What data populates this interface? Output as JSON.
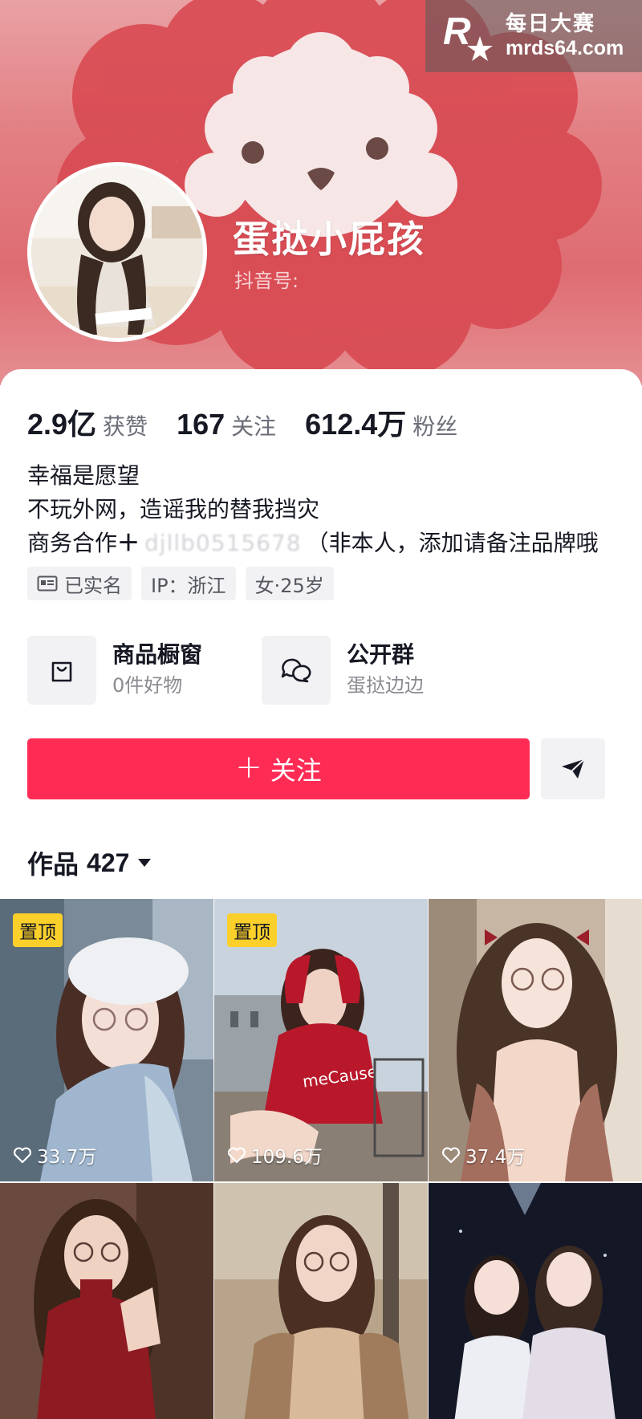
{
  "watermark": {
    "brand_cn": "每日大赛",
    "url": "mrds64.com"
  },
  "profile": {
    "nickname": "蛋挞小屁孩",
    "douyin_id_label": "抖音号:"
  },
  "stats": [
    {
      "value": "2.9亿",
      "label": "获赞"
    },
    {
      "value": "167",
      "label": "关注"
    },
    {
      "value": "612.4万",
      "label": "粉丝"
    }
  ],
  "bio": {
    "line1": "幸福是愿望",
    "line2": "不玩外网，造谣我的替我挡灾",
    "line3_prefix": "商务合作",
    "line3_masked": "djllb0515678",
    "line3_suffix": "（非本人，添加请备注品牌哦"
  },
  "tags": [
    {
      "icon": "id-card-icon",
      "label": "已实名"
    },
    {
      "icon": "",
      "label": "IP：浙江"
    },
    {
      "icon": "",
      "label": "女·25岁"
    }
  ],
  "entries": [
    {
      "icon": "shopping-bag-icon",
      "title": "商品橱窗",
      "subtitle": "0件好物"
    },
    {
      "icon": "group-chat-icon",
      "title": "公开群",
      "subtitle": "蛋挞边边"
    }
  ],
  "actions": {
    "follow_plus": "+",
    "follow_label": "关注",
    "share_icon": "send-icon"
  },
  "works": {
    "label": "作品",
    "count": "427"
  },
  "colors": {
    "accent": "#fe2c55",
    "pin_badge": "#fcd02b",
    "banner": "#e27f83"
  },
  "grid": [
    {
      "pinned": true,
      "pin_label": "置顶",
      "likes": "33.7万"
    },
    {
      "pinned": true,
      "pin_label": "置顶",
      "likes": "109.6万"
    },
    {
      "pinned": false,
      "pin_label": "",
      "likes": "37.4万"
    },
    {
      "pinned": false,
      "pin_label": "",
      "likes": ""
    },
    {
      "pinned": false,
      "pin_label": "",
      "likes": ""
    },
    {
      "pinned": false,
      "pin_label": "",
      "likes": ""
    }
  ]
}
